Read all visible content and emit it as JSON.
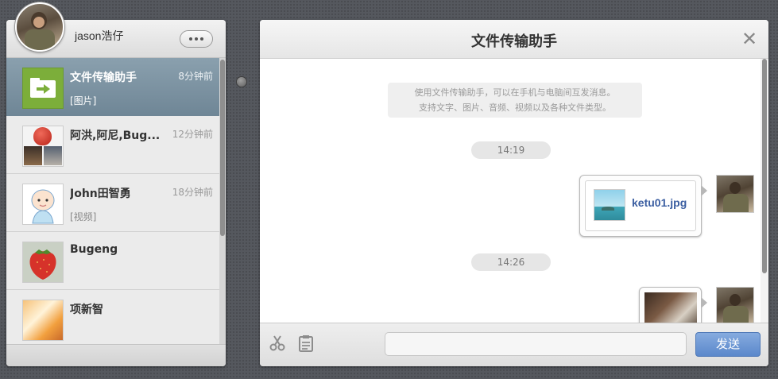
{
  "user": {
    "name": "jason浩仔"
  },
  "conversations": [
    {
      "name": "文件传输助手",
      "time": "8分钟前",
      "preview": "[图片]",
      "active": true
    },
    {
      "name": "阿洪,阿尼,Bug...",
      "time": "12分钟前",
      "preview": ""
    },
    {
      "name": "John田智勇",
      "time": "18分钟前",
      "preview": "[视频]"
    },
    {
      "name": "Bugeng",
      "time": "",
      "preview": ""
    },
    {
      "name": "项新智",
      "time": "",
      "preview": ""
    }
  ],
  "chat": {
    "title": "文件传输助手",
    "close_symbol": "✕",
    "notice_line1": "使用文件传输助手，可以在手机与电脑间互发消息。",
    "notice_line2": "支持文字、图片、音频、视频以及各种文件类型。",
    "timestamps": [
      "14:19",
      "14:26"
    ],
    "file_message": {
      "filename": "ketu01.jpg"
    }
  },
  "footer": {
    "send_label": "发送",
    "input_value": ""
  },
  "icons": {
    "more": "more-icon",
    "close": "close-icon",
    "screenshot": "scissors-icon",
    "clipboard": "clipboard-icon",
    "file_transfer": "arrow-right-icon"
  },
  "colors": {
    "accent": "#5b88cb",
    "active_row": "#7a90a0",
    "file_helper_green": "#7cae3a",
    "filename_link": "#3b5ea1"
  }
}
